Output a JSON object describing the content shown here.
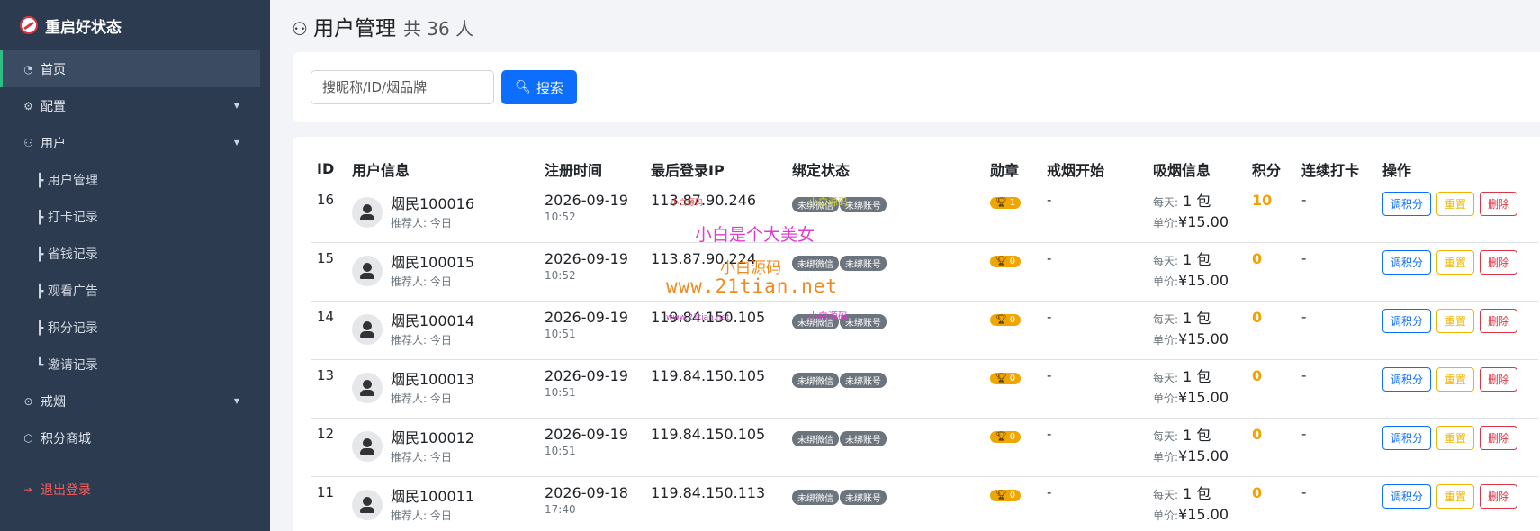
{
  "sidebar": {
    "brand": "重启好状态",
    "items": [
      {
        "label": "首页",
        "icon": "gauge-icon"
      },
      {
        "label": "配置",
        "icon": "gear-icon"
      },
      {
        "label": "用户",
        "icon": "users-icon"
      },
      {
        "label": "┣ 用户管理"
      },
      {
        "label": "┣ 打卡记录"
      },
      {
        "label": "┣ 省钱记录"
      },
      {
        "label": "┣ 观看广告"
      },
      {
        "label": "┣ 积分记录"
      },
      {
        "label": "┗ 邀请记录"
      },
      {
        "label": "戒烟",
        "icon": "controller-icon"
      },
      {
        "label": "积分商城",
        "icon": "box-icon"
      },
      {
        "label": "退出登录",
        "icon": "logout-icon"
      }
    ]
  },
  "header": {
    "title": "用户管理",
    "count": "共 36 人"
  },
  "search": {
    "placeholder": "搜昵称/ID/烟品牌",
    "button_label": "搜索"
  },
  "table": {
    "columns": [
      "ID",
      "用户信息",
      "注册时间",
      "最后登录IP",
      "绑定状态",
      "勋章",
      "戒烟开始",
      "吸烟信息",
      "积分",
      "连续打卡",
      "操作"
    ],
    "rows": [
      {
        "id": "16",
        "name": "烟民100016",
        "ref": "推荐人: 今日",
        "date": "2026-09-19",
        "time": "10:52",
        "ip": "113.87.90.246",
        "wx": "未绑微信",
        "acct": "未绑账号",
        "medal": "1",
        "start": "-",
        "daily_label": "每天:",
        "daily": "1 包",
        "price_label": "单价:",
        "price": "¥15.00",
        "points": "10",
        "streak": "-"
      },
      {
        "id": "15",
        "name": "烟民100015",
        "ref": "推荐人: 今日",
        "date": "2026-09-19",
        "time": "10:52",
        "ip": "113.87.90.224",
        "wx": "未绑微信",
        "acct": "未绑账号",
        "medal": "0",
        "start": "-",
        "daily_label": "每天:",
        "daily": "1 包",
        "price_label": "单价:",
        "price": "¥15.00",
        "points": "0",
        "streak": "-"
      },
      {
        "id": "14",
        "name": "烟民100014",
        "ref": "推荐人: 今日",
        "date": "2026-09-19",
        "time": "10:51",
        "ip": "119.84.150.105",
        "wx": "未绑微信",
        "acct": "未绑账号",
        "medal": "0",
        "start": "-",
        "daily_label": "每天:",
        "daily": "1 包",
        "price_label": "单价:",
        "price": "¥15.00",
        "points": "0",
        "streak": "-"
      },
      {
        "id": "13",
        "name": "烟民100013",
        "ref": "推荐人: 今日",
        "date": "2026-09-19",
        "time": "10:51",
        "ip": "119.84.150.105",
        "wx": "未绑微信",
        "acct": "未绑账号",
        "medal": "0",
        "start": "-",
        "daily_label": "每天:",
        "daily": "1 包",
        "price_label": "单价:",
        "price": "¥15.00",
        "points": "0",
        "streak": "-"
      },
      {
        "id": "12",
        "name": "烟民100012",
        "ref": "推荐人: 今日",
        "date": "2026-09-19",
        "time": "10:51",
        "ip": "119.84.150.105",
        "wx": "未绑微信",
        "acct": "未绑账号",
        "medal": "0",
        "start": "-",
        "daily_label": "每天:",
        "daily": "1 包",
        "price_label": "单价:",
        "price": "¥15.00",
        "points": "0",
        "streak": "-"
      },
      {
        "id": "11",
        "name": "烟民100011",
        "ref": "推荐人: 今日",
        "date": "2026-09-18",
        "time": "17:40",
        "ip": "119.84.150.113",
        "wx": "未绑微信",
        "acct": "未绑账号",
        "medal": "0",
        "start": "-",
        "daily_label": "每天:",
        "daily": "1 包",
        "price_label": "单价:",
        "price": "¥15.00",
        "points": "0",
        "streak": "-"
      }
    ],
    "actions": {
      "adjust": "调积分",
      "reset": "重置",
      "delete": "删除"
    }
  },
  "watermarks": {
    "w1": "小白是个大美女",
    "w2": "www.21tian.net",
    "w3": "小白源码",
    "w4": "小白源码",
    "w5": "小白源码",
    "w6": "小白源码",
    "w7": "www.21tian.net"
  },
  "colors": {
    "sidebar_bg": "#2c3b4f",
    "primary": "#0d6efd",
    "warning": "#f0a500",
    "danger": "#dc3545",
    "active_accent": "#2dbd85"
  }
}
